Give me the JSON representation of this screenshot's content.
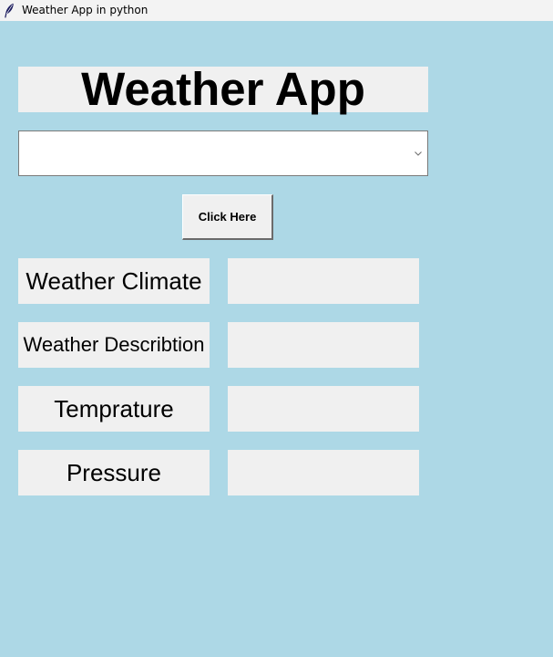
{
  "window": {
    "title": "Weather App in python",
    "icon": "feather-icon"
  },
  "app": {
    "heading": "Weather App"
  },
  "city_select": {
    "value": "",
    "options": []
  },
  "button": {
    "label": "Click Here"
  },
  "fields": [
    {
      "label": "Weather Climate",
      "value": ""
    },
    {
      "label": "Weather Describtion",
      "value": ""
    },
    {
      "label": "Temprature",
      "value": ""
    },
    {
      "label": "Pressure",
      "value": ""
    }
  ],
  "colors": {
    "background": "#ADD8E6",
    "widget": "#F0F0F0",
    "titlebar": "#F3F3F3"
  }
}
